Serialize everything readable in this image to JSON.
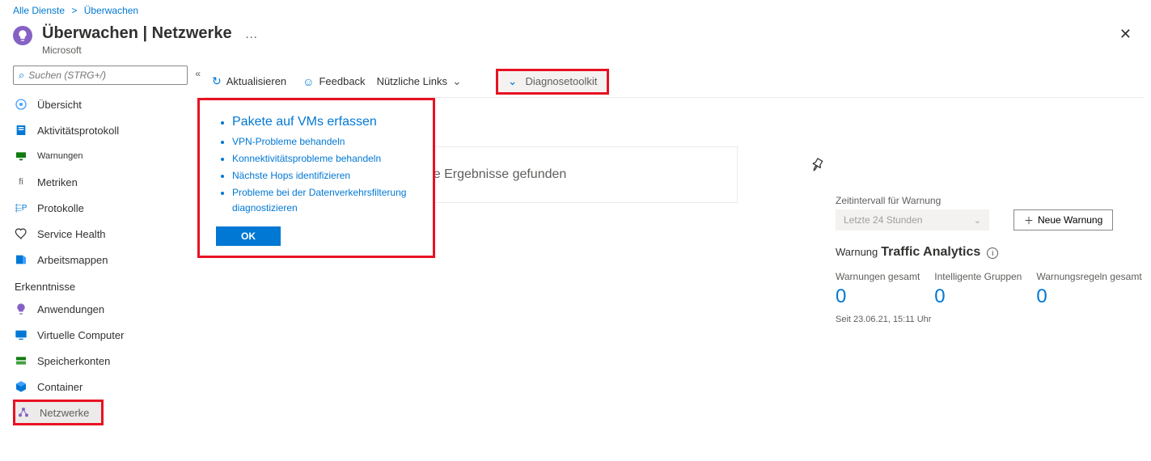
{
  "breadcrumb": {
    "all": "Alle Dienste",
    "sep": ">",
    "monitor": "Überwachen"
  },
  "header": {
    "title": "Überwachen | Netzwerke",
    "sub": "Microsoft",
    "more": "…"
  },
  "search": {
    "placeholder": "Suchen (STRG+/)"
  },
  "nav": {
    "overview": "Übersicht",
    "activity": "Aktivitätsprotokoll",
    "alerts": "Warnungen",
    "metrics": "Metriken",
    "metrics_icon": "fi",
    "logs": "Protokolle",
    "logs_icon": "⬱P",
    "servicehealth": "Service Health",
    "workbooks": "Arbeitsmappen",
    "section_insights": "Erkenntnisse",
    "applications": "Anwendungen",
    "vms": "Virtuelle Computer",
    "storage": "Speicherkonten",
    "container": "Container",
    "networks": "Netzwerke"
  },
  "toolbar": {
    "refresh": "Aktualisieren",
    "feedback": "Feedback",
    "links": "Nützliche Links",
    "diagnose": "Diagnosetoolkit"
  },
  "popup": {
    "title": "Pakete auf VMs erfassen",
    "items": [
      "VPN-Probleme behandeln",
      "Konnektivitätsprobleme behandeln",
      "Nächste Hops identifizieren",
      "Probleme bei der Datenverkehrsfilterung diagnostizieren"
    ],
    "ok": "OK"
  },
  "content": {
    "no_results": "Keine Ergebnisse gefunden"
  },
  "right": {
    "interval_label": "Zeitintervall für Warnung",
    "interval_value": "Letzte 24 Stunden",
    "new_alert": "Neue Warnung",
    "warnung": "Warnung",
    "traffic": "Traffic Analytics",
    "info": "i",
    "stats": {
      "total_label": "Warnungen gesamt",
      "total_val": "0",
      "groups_label": "Intelligente Gruppen",
      "groups_val": "0",
      "rules_label": "Warnungsregeln gesamt",
      "rules_val": "0"
    },
    "since": "Seit 23.06.21, 15:11 Uhr"
  }
}
